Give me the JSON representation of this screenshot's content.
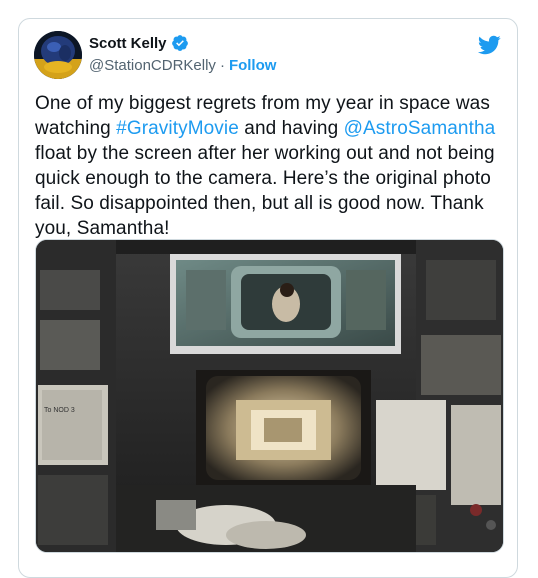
{
  "tweet": {
    "author": {
      "display_name": "Scott Kelly",
      "handle": "@StationCDRKelly",
      "separator": "·",
      "follow_label": "Follow",
      "verified": true
    },
    "text": {
      "part1": "One of my biggest regrets from my year in space was watching ",
      "hashtag": "#GravityMovie",
      "part2": " and having ",
      "mention": "@AstroSamantha",
      "part3": " float by the screen after her working out and not being quick enough to the camera. Here’s the original photo fail. So disappointed then, but all is good now. Thank you, Samantha!"
    },
    "media": {
      "panel_label": "To NOD 3"
    }
  },
  "colors": {
    "link": "#1d9bf0",
    "text": "#0f1419",
    "secondary": "#536471",
    "border": "#cfd9de"
  },
  "icons": [
    "avatar",
    "verified-badge-icon",
    "twitter-bird-icon"
  ]
}
